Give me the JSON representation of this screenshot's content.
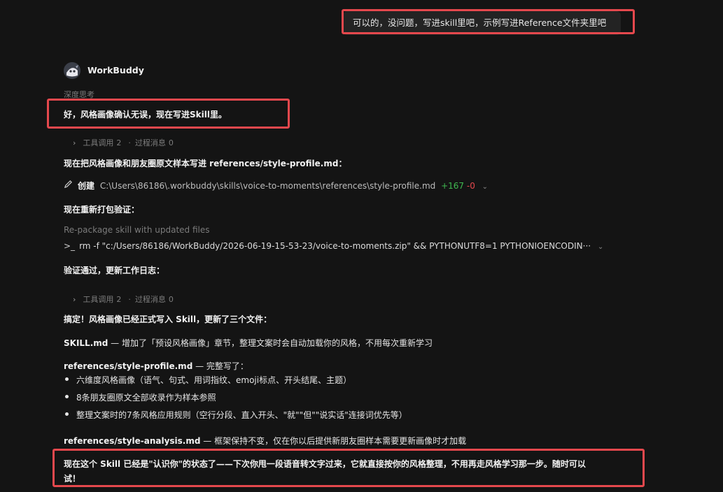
{
  "user_message": "可以的，没问题，写进skill里吧，示例写进Reference文件夹里吧",
  "assistant": {
    "name": "WorkBuddy",
    "thinking_label": "深度思考",
    "intro": "好，风格画像确认无误，现在写进Skill里。",
    "tool_group_1": {
      "tools_label": "工具调用",
      "tools_count": "2",
      "sep": "·",
      "process_label": "过程消息",
      "process_count": "0"
    },
    "line_1": "现在把风格画像和朋友圈原文样本写进 references/style-profile.md：",
    "create_row": {
      "action": "创建",
      "path": "C:\\Users\\86186\\.workbuddy\\skills\\voice-to-moments\\references\\style-profile.md",
      "added": "+167",
      "removed": "-0"
    },
    "line_2": "现在重新打包验证：",
    "command_caption": "Re-package skill with updated files",
    "command_prompt": ">_",
    "command": "rm -f \"c:/Users/86186/WorkBuddy/2026-06-19-15-53-23/voice-to-moments.zip\" && PYTHONUTF8=1 PYTHONIOENCODIN···",
    "line_3": "验证通过，更新工作日志：",
    "tool_group_2": {
      "tools_label": "工具调用",
      "tools_count": "2",
      "sep": "·",
      "process_label": "过程消息",
      "process_count": "0"
    },
    "summary_intro": "搞定！风格画像已经正式写入 Skill，更新了三个文件：",
    "file_1": {
      "name": "SKILL.md",
      "desc": " — 增加了「预设风格画像」章节，整理文案时会自动加载你的风格，不用每次重新学习"
    },
    "file_2": {
      "name": "references/style-profile.md",
      "desc": " — 完整写了：",
      "bullets": [
        "六维度风格画像（语气、句式、用词指纹、emoji标点、开头结尾、主题）",
        "8条朋友圈原文全部收录作为样本参照",
        "整理文案时的7条风格应用规则（空行分段、直入开头、\"就\"\"但\"\"说实话\"连接词优先等）"
      ]
    },
    "file_3": {
      "name": "references/style-analysis.md",
      "desc": " — 框架保持不变，仅在你以后提供新朋友圈样本需要更新画像时才加载"
    },
    "closing_1": "现在这个 Skill 已经是\"认识你\"的状态了——下次你甩一段语音转文字过来，它就直接按你的风格整理，不用再走风格学习那一步。随时可以",
    "closing_2": "试！"
  },
  "colors": {
    "highlight": "#e5484d",
    "added": "#3fb950",
    "removed": "#e5484d"
  }
}
